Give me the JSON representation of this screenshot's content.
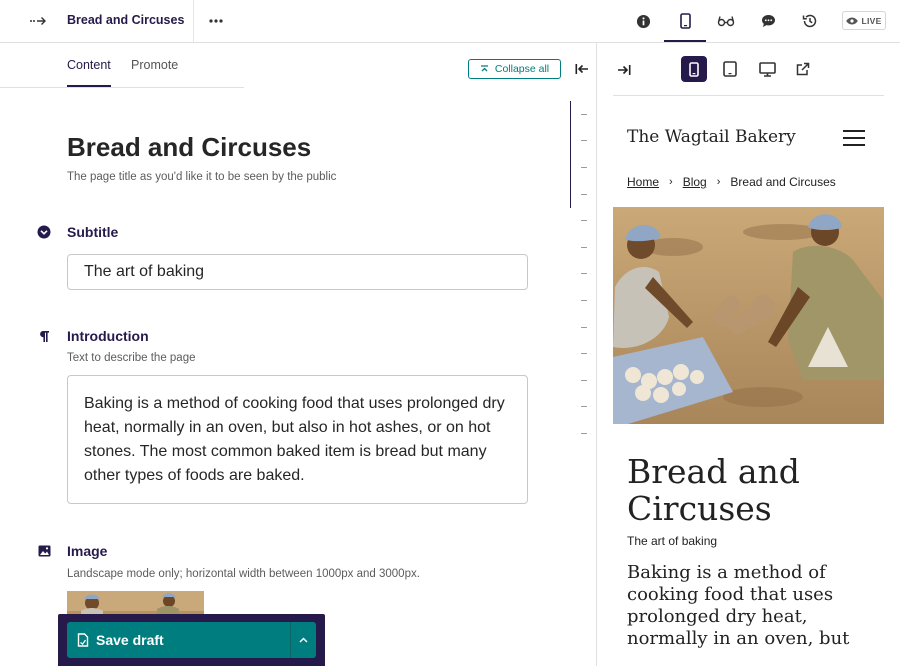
{
  "header": {
    "page_title": "Bread and Circuses",
    "live_label": "LIVE",
    "icons": [
      "arrow-right-dots-icon",
      "more-dots-icon",
      "info-icon",
      "mobile-preview-icon",
      "glasses-icon",
      "comment-icon",
      "history-icon",
      "eye-icon"
    ]
  },
  "editor": {
    "tabs": [
      {
        "label": "Content",
        "active": true
      },
      {
        "label": "Promote",
        "active": false
      }
    ],
    "collapse_all_label": "Collapse all",
    "title": {
      "value": "Bread and Circuses",
      "help": "The page title as you'd like it to be seen by the public"
    },
    "subtitle": {
      "label": "Subtitle",
      "value": "The art of baking"
    },
    "introduction": {
      "label": "Introduction",
      "help": "Text to describe the page",
      "value": "Baking is a method of cooking food that uses prolonged dry heat, normally in an oven, but also in hot ashes, or on hot stones. The most common baked item is bread but many other types of foods are baked."
    },
    "image": {
      "label": "Image",
      "help": "Landscape mode only; horizontal width between 1000px and 3000px."
    },
    "save_label": "Save draft"
  },
  "preview": {
    "site_name": "The Wagtail Bakery",
    "breadcrumbs": [
      "Home",
      "Blog",
      "Bread and Circuses"
    ],
    "title": "Bread and Circuses",
    "subtitle": "The art of baking",
    "intro": "Baking is a method of cooking food that uses prolonged dry heat, normally in an oven, but"
  },
  "colors": {
    "primary": "#261a4b",
    "accent": "#007d7e"
  }
}
